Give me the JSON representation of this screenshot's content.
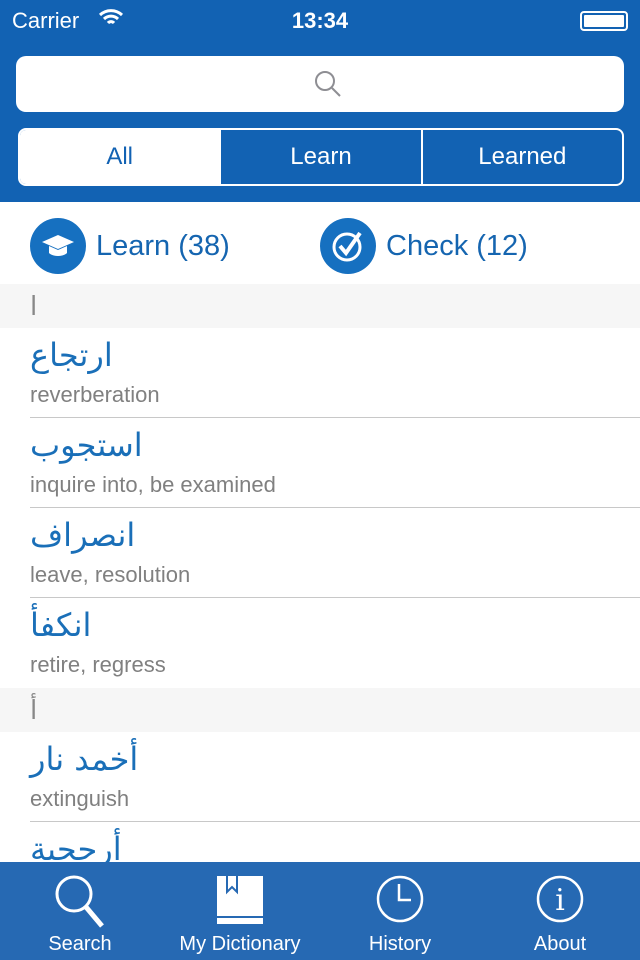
{
  "status": {
    "carrier": "Carrier",
    "time": "13:34"
  },
  "search": {
    "placeholder": ""
  },
  "segments": [
    "All",
    "Learn",
    "Learned"
  ],
  "actions": {
    "learn": "Learn (38)",
    "check": "Check (12)"
  },
  "sections": [
    {
      "letter": "ا",
      "rows": [
        {
          "arabic": "ارتجاع",
          "english": "reverberation"
        },
        {
          "arabic": "استجوب",
          "english": "inquire into, be examined"
        },
        {
          "arabic": "انصراف",
          "english": "leave, resolution"
        },
        {
          "arabic": "انكفأ",
          "english": "retire, regress"
        }
      ]
    },
    {
      "letter": "أ",
      "rows": [
        {
          "arabic": "أخمد نار",
          "english": "extinguish"
        },
        {
          "arabic": "أرجحية",
          "english": ""
        }
      ]
    }
  ],
  "tabs": [
    "Search",
    "My Dictionary",
    "History",
    "About"
  ]
}
